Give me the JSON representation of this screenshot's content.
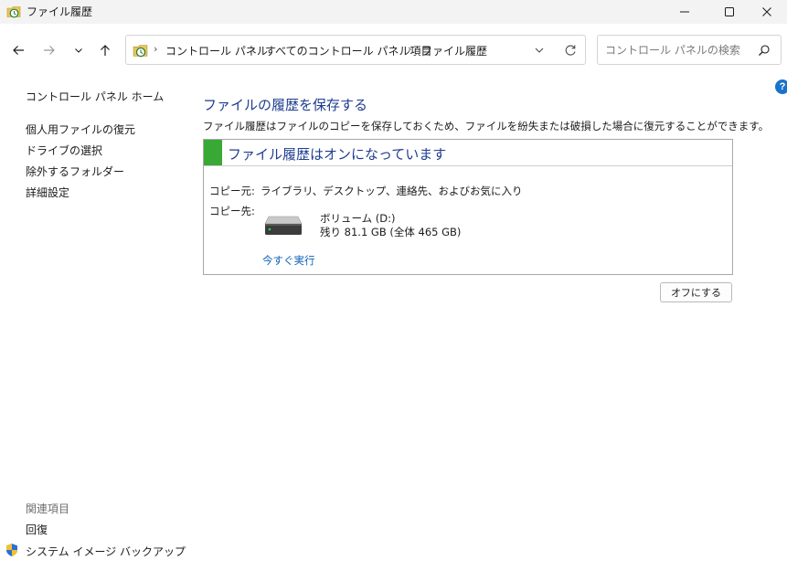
{
  "window": {
    "title": "ファイル履歴"
  },
  "address": {
    "segments": [
      "コントロール パネル",
      "すべてのコントロール パネル項目",
      "ファイル履歴"
    ]
  },
  "search": {
    "placeholder": "コントロール パネルの検索"
  },
  "sidebar": {
    "home": "コントロール パネル ホーム",
    "items": [
      "個人用ファイルの復元",
      "ドライブの選択",
      "除外するフォルダー",
      "詳細設定"
    ],
    "related_title": "関連項目",
    "related": [
      "回復",
      "システム イメージ バックアップ"
    ]
  },
  "main": {
    "title": "ファイルの履歴を保存する",
    "description": "ファイル履歴はファイルのコピーを保存しておくため、ファイルを紛失または破損した場合に復元することができます。",
    "status": "ファイル履歴はオンになっています",
    "copy_from_label": "コピー元:",
    "copy_from_value": "ライブラリ、デスクトップ、連絡先、およびお気に入り",
    "copy_to_label": "コピー先:",
    "drive_name": "ボリューム (D:)",
    "drive_space": "残り 81.1 GB (全体 465 GB)",
    "run_now": "今すぐ実行",
    "off_button": "オフにする"
  },
  "colors": {
    "accent_title": "#1e3d8f",
    "status_green": "#39a935",
    "link": "#0e63b8"
  }
}
